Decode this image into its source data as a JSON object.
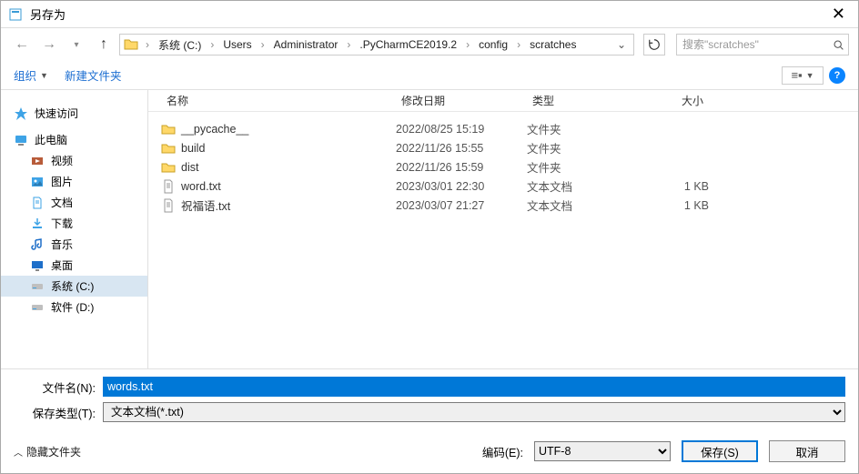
{
  "window": {
    "title": "另存为"
  },
  "breadcrumb": {
    "items": [
      "系统 (C:)",
      "Users",
      "Administrator",
      ".PyCharmCE2019.2",
      "config",
      "scratches"
    ]
  },
  "search": {
    "placeholder": "搜索\"scratches\""
  },
  "toolbar": {
    "organize": "组织",
    "new_folder": "新建文件夹"
  },
  "sidebar": {
    "quick_access": "快速访问",
    "this_pc": "此电脑",
    "video": "视频",
    "pictures": "图片",
    "documents": "文档",
    "downloads": "下载",
    "music": "音乐",
    "desktop": "桌面",
    "drive_c": "系统 (C:)",
    "drive_d": "软件 (D:)"
  },
  "columns": {
    "name": "名称",
    "date": "修改日期",
    "type": "类型",
    "size": "大小"
  },
  "files": [
    {
      "icon": "folder",
      "name": "__pycache__",
      "date": "2022/08/25 15:19",
      "type": "文件夹",
      "size": ""
    },
    {
      "icon": "folder",
      "name": "build",
      "date": "2022/11/26 15:55",
      "type": "文件夹",
      "size": ""
    },
    {
      "icon": "folder",
      "name": "dist",
      "date": "2022/11/26 15:59",
      "type": "文件夹",
      "size": ""
    },
    {
      "icon": "txt",
      "name": "word.txt",
      "date": "2023/03/01 22:30",
      "type": "文本文档",
      "size": "1 KB"
    },
    {
      "icon": "txt",
      "name": "祝福语.txt",
      "date": "2023/03/07 21:27",
      "type": "文本文档",
      "size": "1 KB"
    }
  ],
  "form": {
    "filename_label": "文件名(N):",
    "filename_value": "words.txt",
    "filetype_label": "保存类型(T):",
    "filetype_value": "文本文档(*.txt)"
  },
  "footer": {
    "hide_folders": "隐藏文件夹",
    "encoding_label": "编码(E):",
    "encoding_value": "UTF-8",
    "save": "保存(S)",
    "cancel": "取消"
  }
}
